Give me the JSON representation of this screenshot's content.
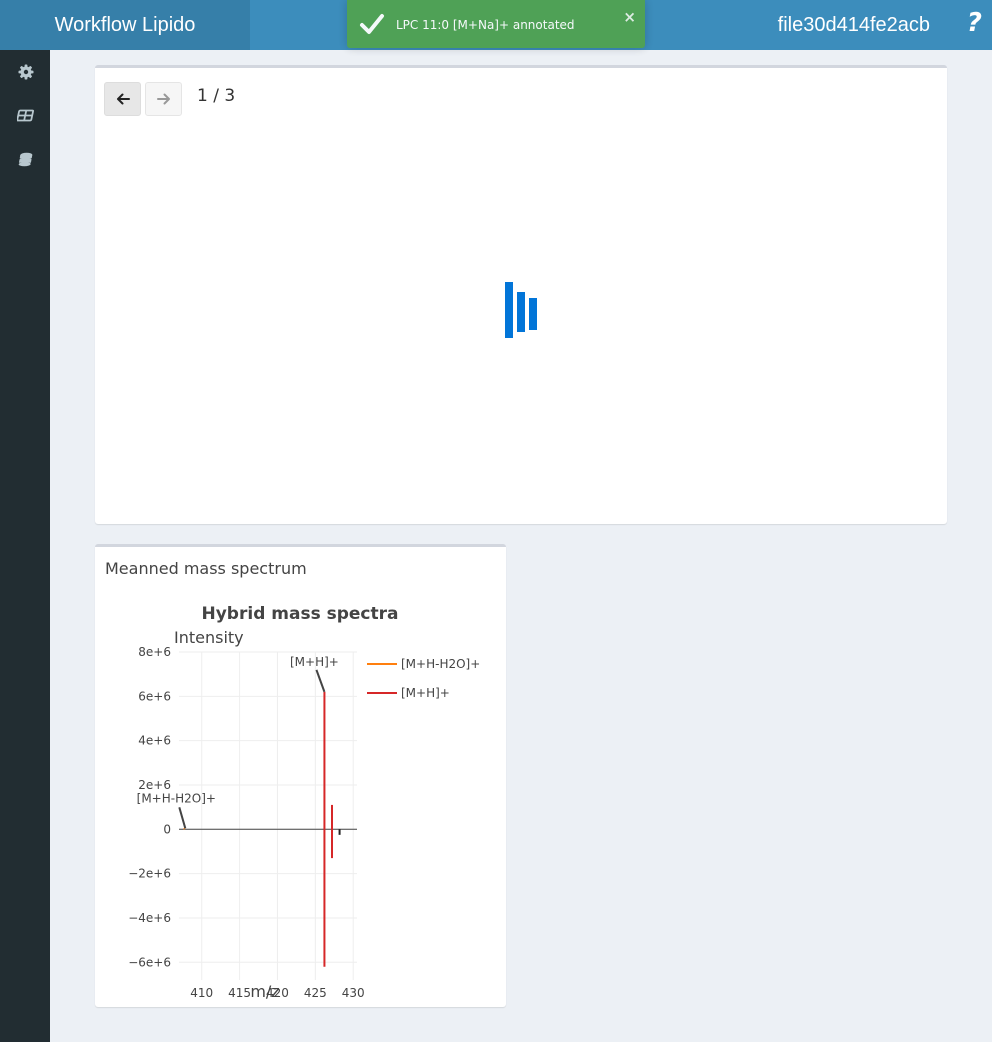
{
  "header": {
    "app_title": "Workflow Lipido",
    "file_name": "file30d414fe2acb",
    "help_label": "?"
  },
  "toast": {
    "message": "LPC 11:0 [M+Na]+ annotated",
    "close_label": "×"
  },
  "sidebar": {
    "items": [
      {
        "icon": "gear-icon"
      },
      {
        "icon": "table-icon"
      },
      {
        "icon": "database-icon"
      }
    ]
  },
  "viewer": {
    "page_indicator": "1 / 3",
    "prev_icon": "arrow-left-icon",
    "next_icon": "arrow-right-icon"
  },
  "spectrum_box": {
    "title": "Meanned mass spectrum"
  },
  "chart_data": {
    "type": "line",
    "title": "Hybrid mass spectra",
    "xlabel": "m/z",
    "ylabel": "Intensity",
    "xlim": [
      407,
      430.5
    ],
    "ylim": [
      -6800000,
      8000000
    ],
    "xticks": [
      410,
      415,
      420,
      425,
      430
    ],
    "xtick_labels": [
      "410",
      "415",
      "420",
      "425",
      "430"
    ],
    "yticks": [
      -6000000,
      -4000000,
      -2000000,
      0,
      2000000,
      4000000,
      6000000,
      8000000
    ],
    "ytick_labels": [
      "−6e+6",
      "−4e+6",
      "−2e+6",
      "0",
      "2e+6",
      "4e+6",
      "6e+6",
      "8e+6"
    ],
    "grid": true,
    "legend_position": "top-right",
    "series": [
      {
        "name": "[M+H-H2O]+",
        "color": "#ff7f0e",
        "peaks": [
          {
            "mz": 407.7,
            "intensity": 0
          }
        ]
      },
      {
        "name": "[M+H]+",
        "color": "#d62728",
        "peaks": [
          {
            "mz": 426.2,
            "intensity": 6200000
          },
          {
            "mz": 427.2,
            "intensity": 1100000
          },
          {
            "mz": 426.2,
            "intensity": -6200000
          },
          {
            "mz": 427.2,
            "intensity": -1300000
          }
        ]
      },
      {
        "name": "",
        "color": "#222222",
        "peaks": [
          {
            "mz": 428.2,
            "intensity": -250000
          }
        ]
      }
    ],
    "annotations": [
      {
        "text": "[M+H]+",
        "mz": 426.2,
        "intensity": 6200000
      },
      {
        "text": "[M+H-H2O]+",
        "mz": 407.7,
        "intensity": 0
      }
    ]
  }
}
